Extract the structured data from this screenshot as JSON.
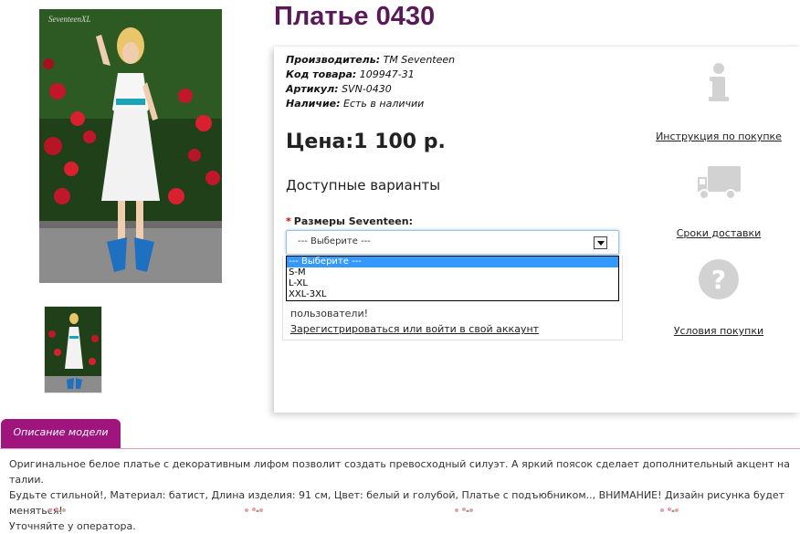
{
  "product": {
    "title": "Платье 0430",
    "manufacturer_label": "Производитель:",
    "manufacturer_value": "ТМ Seventeen",
    "code_label": "Код товара:",
    "code_value": "109947-31",
    "sku_label": "Артикул:",
    "sku_value": "SVN-0430",
    "stock_label": "Наличие:",
    "stock_value": "Есть в наличии",
    "price": "Цена:1 100 р.",
    "photo_watermark": "SeventeenXL"
  },
  "options": {
    "heading": "Доступные варианты",
    "size_label": "Размеры Seventeen:",
    "select_value": "--- Выберите ---",
    "dropdown_items": [
      "--- Выберите ---",
      "S-M",
      "L-XL",
      "XXL-3XL"
    ]
  },
  "login_notice": {
    "text": "пользователи!",
    "link": "Зарегистрироваться или войти в свой аккаунт"
  },
  "sidebar": {
    "items": [
      {
        "icon": "info-icon",
        "label": "Инструкция по покупке"
      },
      {
        "icon": "truck-icon",
        "label": "Сроки доставки"
      },
      {
        "icon": "question-icon",
        "label": "Условия покупки"
      }
    ]
  },
  "description": {
    "tab_label": "Описание модели",
    "text_line1": "Оригинальное белое платье с декоративным лифом позволит создать превосходный силуэт. А яркий поясок сделает дополнительный акцент на талии.",
    "text_line2": "Будьте стильной!, Материал: батист, Длина изделия: 91 см, Цвет: белый и голубой, Платье с подъюбником.., ВНИМАНИЕ! Дизайн рисунка будет меняться!",
    "text_line3": "Уточняйте у оператора."
  },
  "colors": {
    "title": "#5a1a5a",
    "tab": "#a0147e",
    "dropdown_highlight": "#3399ff",
    "icon_gray": "#d2d2d2"
  }
}
